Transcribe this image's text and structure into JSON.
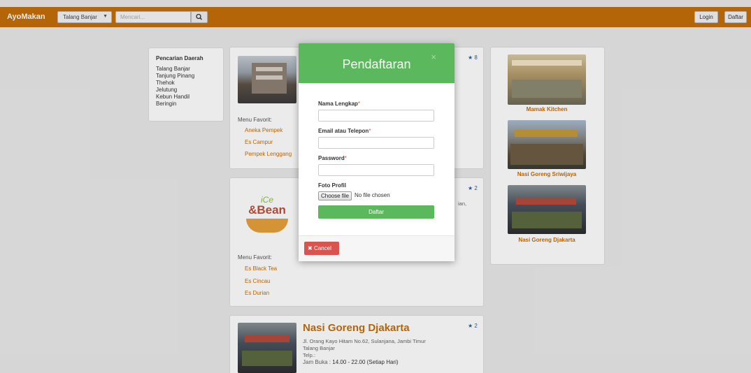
{
  "navbar": {
    "brand": "AyoMakan",
    "area_selected": "Talang Banjar",
    "search_placeholder": "Mencari...",
    "login_label": "Login",
    "register_label": "Daftar",
    "bg_color": "#c46e09"
  },
  "sidebar": {
    "title": "Pencarian Daerah",
    "items": [
      "Talang Banjar",
      "Tanjung Pinang",
      "Thehok",
      "Jelutung",
      "Kebun Handil",
      "Beringin"
    ]
  },
  "restaurants": [
    {
      "rating": "8",
      "menu_label": "Menu Favorit:",
      "menu": [
        "Aneka Pempek",
        "Es Campur",
        "Pempek Lenggang"
      ]
    },
    {
      "rating": "2",
      "logo_text_1": "iCe",
      "logo_text_2": "&Bean",
      "desc_fragment": "ian,",
      "menu_label": "Menu Favorit:",
      "menu": [
        "Es Black Tea",
        "Es Cincau",
        "Es Durian"
      ]
    },
    {
      "rating": "2",
      "name": "Nasi Goreng Djakarta",
      "address": "Jl. Orang Kayo Hitam No.62, Sulanjana, Jambi Timur",
      "area": "Talang Banjar",
      "phone": "Telp.:",
      "hours_label": "Jam Buka :",
      "hours": "14.00 - 22.00 (Setiap Hari)"
    }
  ],
  "recommended": [
    "Mamak Kitchen",
    "Nasi Goreng Sriwijaya",
    "Nasi Goreng Djakarta"
  ],
  "modal": {
    "title": "Pendaftaran",
    "close_symbol": "×",
    "fields": {
      "name_label": "Nama Lengkap",
      "email_label": "Email atau Telepon",
      "password_label": "Password",
      "photo_label": "Foto Profil",
      "required_mark": "*"
    },
    "file_button": "Choose file",
    "file_status": "No file chosen",
    "submit_label": "Daftar",
    "cancel_label": "Cancel",
    "cancel_icon": "✖",
    "accent_color": "#5cb85c",
    "danger_color": "#d9534f"
  }
}
